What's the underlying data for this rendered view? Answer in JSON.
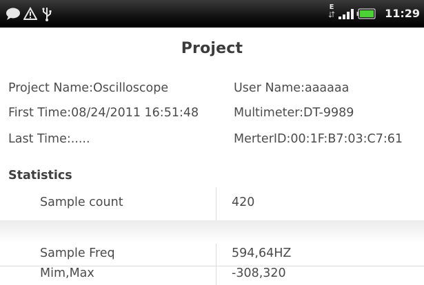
{
  "status_bar": {
    "icons": [
      "chat-bubble-icon",
      "warning-triangle-icon",
      "usb-icon",
      "network-e-icon",
      "signal-bars-icon",
      "battery-icon"
    ],
    "network_letter": "E",
    "time": "11:29",
    "battery_color": "#4cd137"
  },
  "page": {
    "title": "Project"
  },
  "project_info": {
    "project_name": "Project Name:Oscilloscope",
    "first_time": "First Time:08/24/2011 16:51:48",
    "last_time": "Last Time:.....",
    "user_name": "User Name:aaaaaa",
    "multimeter": "Multimeter:DT-9989",
    "meter_id": "MerterID:00:1F:B7:03:C7:61"
  },
  "statistics": {
    "title": "Statistics",
    "rows": [
      {
        "label": "Sample count",
        "value": "420"
      },
      {
        "label": "Sample Freq",
        "value": "594,64HZ"
      },
      {
        "label": "Mim,Max",
        "value": "-308,320"
      }
    ]
  }
}
